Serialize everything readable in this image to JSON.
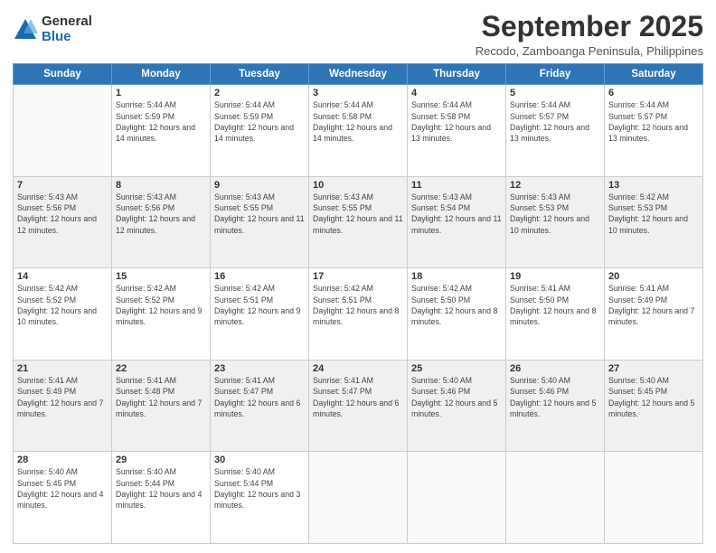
{
  "logo": {
    "general": "General",
    "blue": "Blue"
  },
  "header": {
    "month": "September 2025",
    "location": "Recodo, Zamboanga Peninsula, Philippines"
  },
  "weekdays": [
    "Sunday",
    "Monday",
    "Tuesday",
    "Wednesday",
    "Thursday",
    "Friday",
    "Saturday"
  ],
  "weeks": [
    [
      {
        "day": "",
        "sunrise": "",
        "sunset": "",
        "daylight": ""
      },
      {
        "day": "1",
        "sunrise": "Sunrise: 5:44 AM",
        "sunset": "Sunset: 5:59 PM",
        "daylight": "Daylight: 12 hours and 14 minutes."
      },
      {
        "day": "2",
        "sunrise": "Sunrise: 5:44 AM",
        "sunset": "Sunset: 5:59 PM",
        "daylight": "Daylight: 12 hours and 14 minutes."
      },
      {
        "day": "3",
        "sunrise": "Sunrise: 5:44 AM",
        "sunset": "Sunset: 5:58 PM",
        "daylight": "Daylight: 12 hours and 14 minutes."
      },
      {
        "day": "4",
        "sunrise": "Sunrise: 5:44 AM",
        "sunset": "Sunset: 5:58 PM",
        "daylight": "Daylight: 12 hours and 13 minutes."
      },
      {
        "day": "5",
        "sunrise": "Sunrise: 5:44 AM",
        "sunset": "Sunset: 5:57 PM",
        "daylight": "Daylight: 12 hours and 13 minutes."
      },
      {
        "day": "6",
        "sunrise": "Sunrise: 5:44 AM",
        "sunset": "Sunset: 5:57 PM",
        "daylight": "Daylight: 12 hours and 13 minutes."
      }
    ],
    [
      {
        "day": "7",
        "sunrise": "Sunrise: 5:43 AM",
        "sunset": "Sunset: 5:56 PM",
        "daylight": "Daylight: 12 hours and 12 minutes."
      },
      {
        "day": "8",
        "sunrise": "Sunrise: 5:43 AM",
        "sunset": "Sunset: 5:56 PM",
        "daylight": "Daylight: 12 hours and 12 minutes."
      },
      {
        "day": "9",
        "sunrise": "Sunrise: 5:43 AM",
        "sunset": "Sunset: 5:55 PM",
        "daylight": "Daylight: 12 hours and 11 minutes."
      },
      {
        "day": "10",
        "sunrise": "Sunrise: 5:43 AM",
        "sunset": "Sunset: 5:55 PM",
        "daylight": "Daylight: 12 hours and 11 minutes."
      },
      {
        "day": "11",
        "sunrise": "Sunrise: 5:43 AM",
        "sunset": "Sunset: 5:54 PM",
        "daylight": "Daylight: 12 hours and 11 minutes."
      },
      {
        "day": "12",
        "sunrise": "Sunrise: 5:43 AM",
        "sunset": "Sunset: 5:53 PM",
        "daylight": "Daylight: 12 hours and 10 minutes."
      },
      {
        "day": "13",
        "sunrise": "Sunrise: 5:42 AM",
        "sunset": "Sunset: 5:53 PM",
        "daylight": "Daylight: 12 hours and 10 minutes."
      }
    ],
    [
      {
        "day": "14",
        "sunrise": "Sunrise: 5:42 AM",
        "sunset": "Sunset: 5:52 PM",
        "daylight": "Daylight: 12 hours and 10 minutes."
      },
      {
        "day": "15",
        "sunrise": "Sunrise: 5:42 AM",
        "sunset": "Sunset: 5:52 PM",
        "daylight": "Daylight: 12 hours and 9 minutes."
      },
      {
        "day": "16",
        "sunrise": "Sunrise: 5:42 AM",
        "sunset": "Sunset: 5:51 PM",
        "daylight": "Daylight: 12 hours and 9 minutes."
      },
      {
        "day": "17",
        "sunrise": "Sunrise: 5:42 AM",
        "sunset": "Sunset: 5:51 PM",
        "daylight": "Daylight: 12 hours and 8 minutes."
      },
      {
        "day": "18",
        "sunrise": "Sunrise: 5:42 AM",
        "sunset": "Sunset: 5:50 PM",
        "daylight": "Daylight: 12 hours and 8 minutes."
      },
      {
        "day": "19",
        "sunrise": "Sunrise: 5:41 AM",
        "sunset": "Sunset: 5:50 PM",
        "daylight": "Daylight: 12 hours and 8 minutes."
      },
      {
        "day": "20",
        "sunrise": "Sunrise: 5:41 AM",
        "sunset": "Sunset: 5:49 PM",
        "daylight": "Daylight: 12 hours and 7 minutes."
      }
    ],
    [
      {
        "day": "21",
        "sunrise": "Sunrise: 5:41 AM",
        "sunset": "Sunset: 5:49 PM",
        "daylight": "Daylight: 12 hours and 7 minutes."
      },
      {
        "day": "22",
        "sunrise": "Sunrise: 5:41 AM",
        "sunset": "Sunset: 5:48 PM",
        "daylight": "Daylight: 12 hours and 7 minutes."
      },
      {
        "day": "23",
        "sunrise": "Sunrise: 5:41 AM",
        "sunset": "Sunset: 5:47 PM",
        "daylight": "Daylight: 12 hours and 6 minutes."
      },
      {
        "day": "24",
        "sunrise": "Sunrise: 5:41 AM",
        "sunset": "Sunset: 5:47 PM",
        "daylight": "Daylight: 12 hours and 6 minutes."
      },
      {
        "day": "25",
        "sunrise": "Sunrise: 5:40 AM",
        "sunset": "Sunset: 5:46 PM",
        "daylight": "Daylight: 12 hours and 5 minutes."
      },
      {
        "day": "26",
        "sunrise": "Sunrise: 5:40 AM",
        "sunset": "Sunset: 5:46 PM",
        "daylight": "Daylight: 12 hours and 5 minutes."
      },
      {
        "day": "27",
        "sunrise": "Sunrise: 5:40 AM",
        "sunset": "Sunset: 5:45 PM",
        "daylight": "Daylight: 12 hours and 5 minutes."
      }
    ],
    [
      {
        "day": "28",
        "sunrise": "Sunrise: 5:40 AM",
        "sunset": "Sunset: 5:45 PM",
        "daylight": "Daylight: 12 hours and 4 minutes."
      },
      {
        "day": "29",
        "sunrise": "Sunrise: 5:40 AM",
        "sunset": "Sunset: 5:44 PM",
        "daylight": "Daylight: 12 hours and 4 minutes."
      },
      {
        "day": "30",
        "sunrise": "Sunrise: 5:40 AM",
        "sunset": "Sunset: 5:44 PM",
        "daylight": "Daylight: 12 hours and 3 minutes."
      },
      {
        "day": "",
        "sunrise": "",
        "sunset": "",
        "daylight": ""
      },
      {
        "day": "",
        "sunrise": "",
        "sunset": "",
        "daylight": ""
      },
      {
        "day": "",
        "sunrise": "",
        "sunset": "",
        "daylight": ""
      },
      {
        "day": "",
        "sunrise": "",
        "sunset": "",
        "daylight": ""
      }
    ]
  ]
}
